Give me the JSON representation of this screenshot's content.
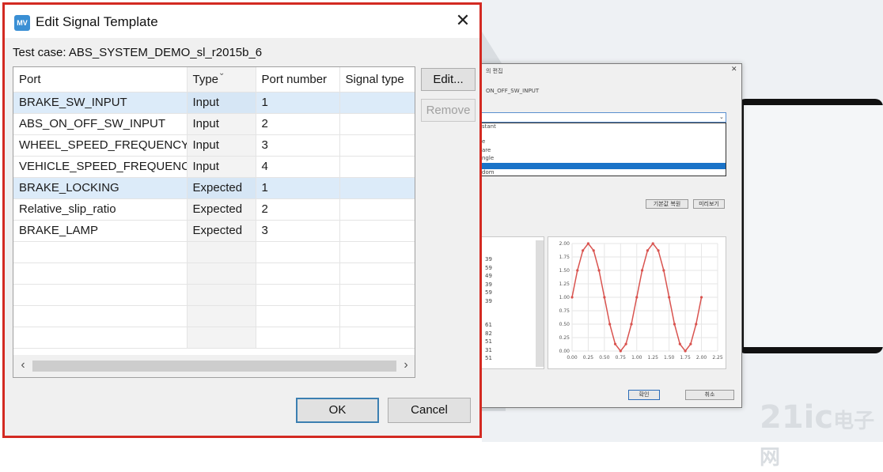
{
  "dialog": {
    "title": "Edit Signal Template",
    "app_icon_text": "MV",
    "test_case": "Test case: ABS_SYSTEM_DEMO_sl_r2015b_6",
    "columns": [
      "Port",
      "Type",
      "Port number",
      "Signal type"
    ],
    "rows": [
      {
        "port": "BRAKE_SW_INPUT",
        "type": "Input",
        "number": "1",
        "signal": "",
        "selected": true
      },
      {
        "port": "ABS_ON_OFF_SW_INPUT",
        "type": "Input",
        "number": "2",
        "signal": "",
        "selected": false
      },
      {
        "port": "WHEEL_SPEED_FREQUENCY",
        "type": "Input",
        "number": "3",
        "signal": "",
        "selected": false
      },
      {
        "port": "VEHICLE_SPEED_FREQUENCY",
        "type": "Input",
        "number": "4",
        "signal": "",
        "selected": false
      },
      {
        "port": "BRAKE_LOCKING",
        "type": "Expected",
        "number": "1",
        "signal": "",
        "selected": true
      },
      {
        "port": "Relative_slip_ratio",
        "type": "Expected",
        "number": "2",
        "signal": "",
        "selected": false
      },
      {
        "port": "BRAKE_LAMP",
        "type": "Expected",
        "number": "3",
        "signal": "",
        "selected": false
      }
    ],
    "buttons": {
      "edit": "Edit...",
      "remove": "Remove",
      "ok": "OK",
      "cancel": "Cancel"
    },
    "close_icon": "close-icon"
  },
  "background_dialog": {
    "title_fragment": "의 편집",
    "port_fragment": "ON_OFF_SW_INPUT",
    "list_items": [
      "stant",
      "e",
      "are",
      "ngle",
      "dom"
    ],
    "btn_copy": "기본값 복원",
    "btn_preview": "미리보기",
    "left_values": [
      "39",
      "59",
      "49",
      "39",
      "59",
      "39",
      "61",
      "82",
      "51",
      "31",
      "51"
    ],
    "btn_ok": "확인",
    "btn_cancel": "취소"
  },
  "chart_data": {
    "type": "line",
    "x": [
      0,
      0.083,
      0.167,
      0.25,
      0.333,
      0.417,
      0.5,
      0.583,
      0.667,
      0.75,
      0.833,
      0.917,
      1.0,
      1.083,
      1.167,
      1.25,
      1.333,
      1.417,
      1.5,
      1.583,
      1.667,
      1.75,
      1.833,
      1.917,
      2.0
    ],
    "y": [
      1.0,
      1.5,
      1.87,
      2.0,
      1.87,
      1.5,
      1.0,
      0.5,
      0.13,
      0.0,
      0.13,
      0.5,
      1.0,
      1.5,
      1.87,
      2.0,
      1.87,
      1.5,
      1.0,
      0.5,
      0.13,
      0.0,
      0.13,
      0.5,
      1.0
    ],
    "xlim": [
      0,
      2.25
    ],
    "ylim": [
      0,
      2.0
    ],
    "x_ticks": [
      "0.00",
      "0.25",
      "0.50",
      "0.75",
      "1.00",
      "1.25",
      "1.50",
      "1.75",
      "2.00",
      "2.25"
    ],
    "y_ticks": [
      "0.00",
      "0.25",
      "0.50",
      "0.75",
      "1.00",
      "1.25",
      "1.50",
      "1.75",
      "2.00"
    ],
    "color": "#d9534f",
    "grid": true
  },
  "colors": {
    "border_highlight": "#d32a22",
    "selection": "#dcebf9",
    "accent": "#1a73c8"
  },
  "watermark": {
    "text1": "21ic",
    "text2": "电子网"
  }
}
